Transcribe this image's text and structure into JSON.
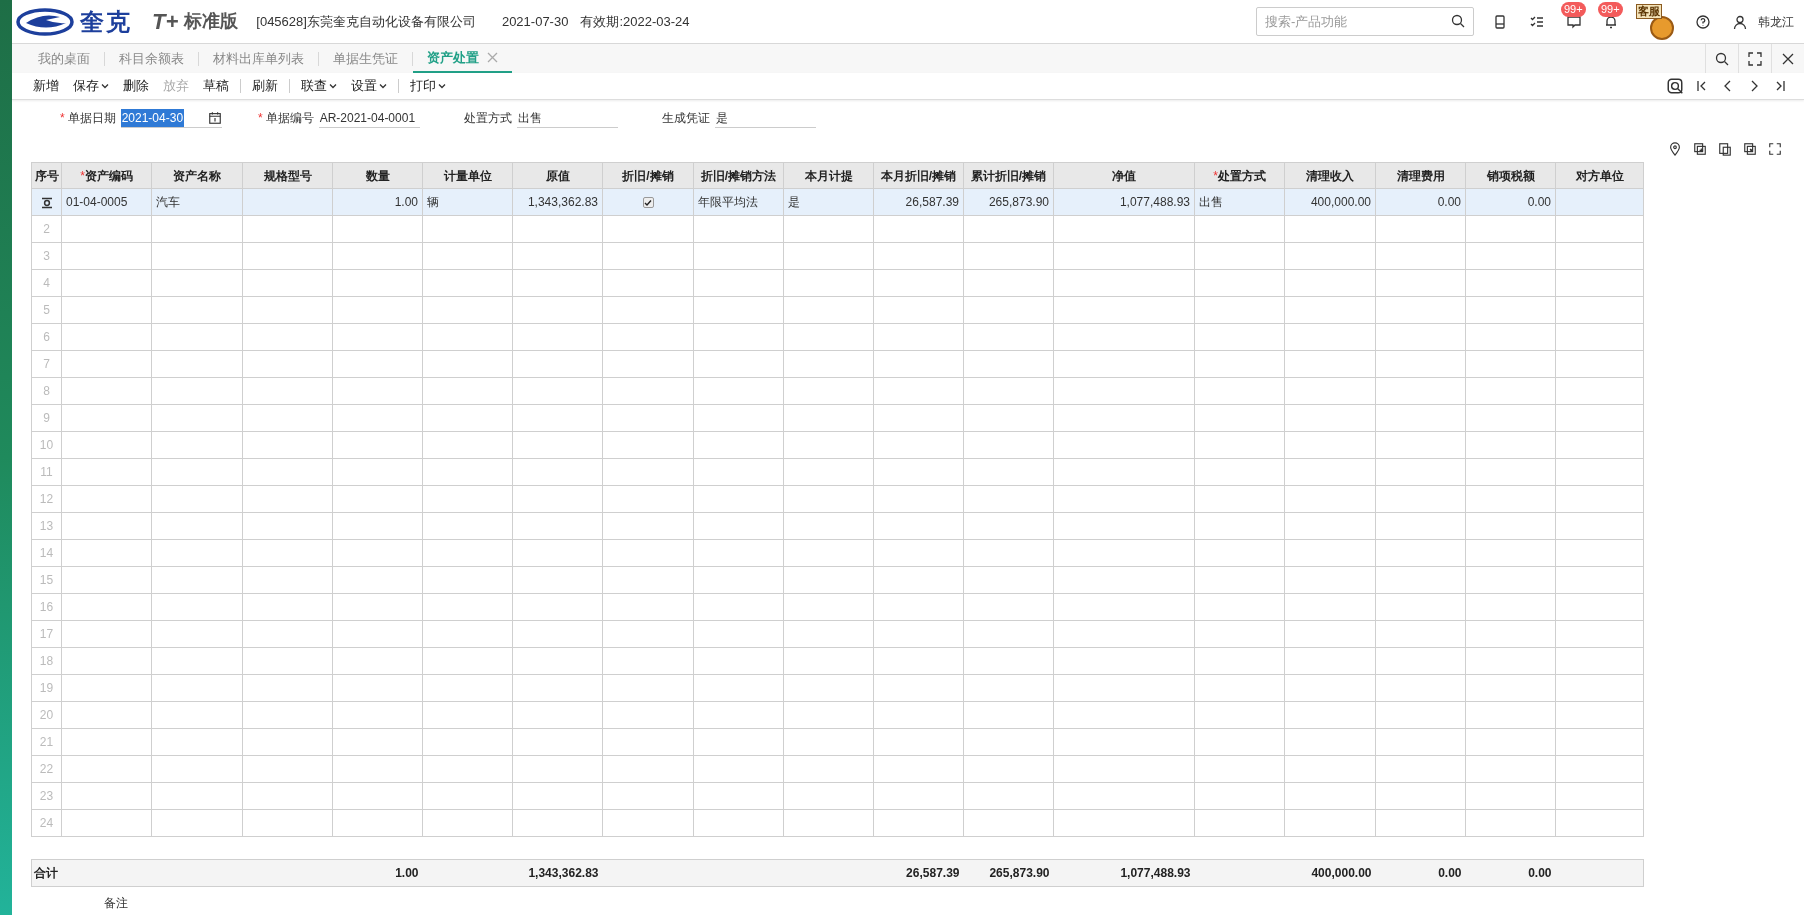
{
  "header": {
    "brand": "奎克",
    "product": "T+",
    "edition": "标准版",
    "company": "[045628]东莞奎克自动化设备有限公司",
    "date": "2021-07-30",
    "validity": "有效期:2022-03-24",
    "search": {
      "placeholder": "搜索-产品功能"
    },
    "message_badge": "99+",
    "alert_badge": "99+",
    "service_sign": "客服",
    "user": "韩龙江"
  },
  "tabs": [
    {
      "label": "我的桌面",
      "selected": false,
      "closable": false
    },
    {
      "label": "科目余额表",
      "selected": false,
      "closable": false
    },
    {
      "label": "材料出库单列表",
      "selected": false,
      "closable": false
    },
    {
      "label": "单据生凭证",
      "selected": false,
      "closable": false
    },
    {
      "label": "资产处置",
      "selected": true,
      "closable": true
    }
  ],
  "toolbar": {
    "groups": [
      {
        "items": [
          {
            "label": "新增",
            "dropdown": false,
            "disabled": false
          },
          {
            "label": "保存",
            "dropdown": true,
            "disabled": false
          },
          {
            "label": "删除",
            "dropdown": false,
            "disabled": false
          },
          {
            "label": "放弃",
            "dropdown": false,
            "disabled": true
          },
          {
            "label": "草稿",
            "dropdown": false,
            "disabled": false
          }
        ]
      },
      {
        "items": [
          {
            "label": "刷新",
            "dropdown": false,
            "disabled": false
          }
        ]
      },
      {
        "items": [
          {
            "label": "联查",
            "dropdown": true,
            "disabled": false
          },
          {
            "label": "设置",
            "dropdown": true,
            "disabled": false
          }
        ]
      },
      {
        "items": [
          {
            "label": "打印",
            "dropdown": true,
            "disabled": false
          }
        ]
      }
    ]
  },
  "form": [
    {
      "required_mark": "*",
      "label": "单据日期",
      "value": "2021-04-30",
      "kind": "date",
      "highlighted": true
    },
    {
      "required_mark": "*",
      "label": "单据编号",
      "value": "AR-2021-04-0001",
      "kind": "text",
      "highlighted": false
    },
    {
      "label": "处置方式",
      "value": "出售",
      "kind": "text",
      "highlighted": false
    },
    {
      "label": "生成凭证",
      "value": "是",
      "kind": "text",
      "highlighted": false
    }
  ],
  "table": {
    "columns": [
      {
        "label": "序号",
        "kind": "index"
      },
      {
        "required_mark": "*",
        "label": "资产编码",
        "kind": "text"
      },
      {
        "label": "资产名称",
        "kind": "text"
      },
      {
        "label": "规格型号",
        "kind": "text"
      },
      {
        "label": "数量",
        "kind": "number"
      },
      {
        "label": "计量单位",
        "kind": "text"
      },
      {
        "label": "原值",
        "kind": "number"
      },
      {
        "label": "折旧/摊销",
        "kind": "check"
      },
      {
        "label": "折旧/摊销方法",
        "kind": "text"
      },
      {
        "label": "本月计提",
        "kind": "text"
      },
      {
        "label": "本月折旧/摊销",
        "kind": "number"
      },
      {
        "label": "累计折旧/摊销",
        "kind": "number"
      },
      {
        "label": "净值",
        "kind": "wide"
      },
      {
        "required_mark": "*",
        "label": "处置方式",
        "kind": "text"
      },
      {
        "label": "清理收入",
        "kind": "number"
      },
      {
        "label": "清理费用",
        "kind": "number"
      },
      {
        "label": "销项税额",
        "kind": "number"
      },
      {
        "label": "对方单位",
        "kind": "text"
      }
    ],
    "rows": [
      {
        "selected": true,
        "cells": [
          null,
          "01-04-0005",
          "汽车",
          null,
          "1.00",
          "辆",
          "1,343,362.83",
          {
            "checked": true
          },
          "年限平均法",
          "是",
          "26,587.39",
          "265,873.90",
          "1,077,488.93",
          "出售",
          "400,000.00",
          "0.00",
          "0.00",
          null
        ]
      },
      {
        "selected": false,
        "number": "2"
      },
      {
        "selected": false,
        "number": "3"
      },
      {
        "selected": false,
        "number": "4"
      },
      {
        "selected": false,
        "number": "5"
      },
      {
        "selected": false,
        "number": "6"
      },
      {
        "selected": false,
        "number": "7"
      },
      {
        "selected": false,
        "number": "8"
      },
      {
        "selected": false,
        "number": "9"
      },
      {
        "selected": false,
        "number": "10"
      },
      {
        "selected": false,
        "number": "11"
      },
      {
        "selected": false,
        "number": "12"
      },
      {
        "selected": false,
        "number": "13"
      },
      {
        "selected": false,
        "number": "14"
      },
      {
        "selected": false,
        "number": "15"
      },
      {
        "selected": false,
        "number": "16"
      },
      {
        "selected": false,
        "number": "17"
      },
      {
        "selected": false,
        "number": "18"
      },
      {
        "selected": false,
        "number": "19"
      },
      {
        "selected": false,
        "number": "20"
      },
      {
        "selected": false,
        "number": "21"
      },
      {
        "selected": false,
        "number": "22"
      },
      {
        "selected": false,
        "number": "23"
      },
      {
        "selected": false,
        "number": "24"
      }
    ]
  },
  "totals": {
    "label": "合计",
    "cells": [
      null,
      null,
      null,
      null,
      "1.00",
      null,
      "1,343,362.83",
      null,
      null,
      null,
      "26,587.39",
      "265,873.90",
      "1,077,488.93",
      null,
      "400,000.00",
      "0.00",
      "0.00",
      null
    ]
  },
  "remark": {
    "label": "备注"
  }
}
